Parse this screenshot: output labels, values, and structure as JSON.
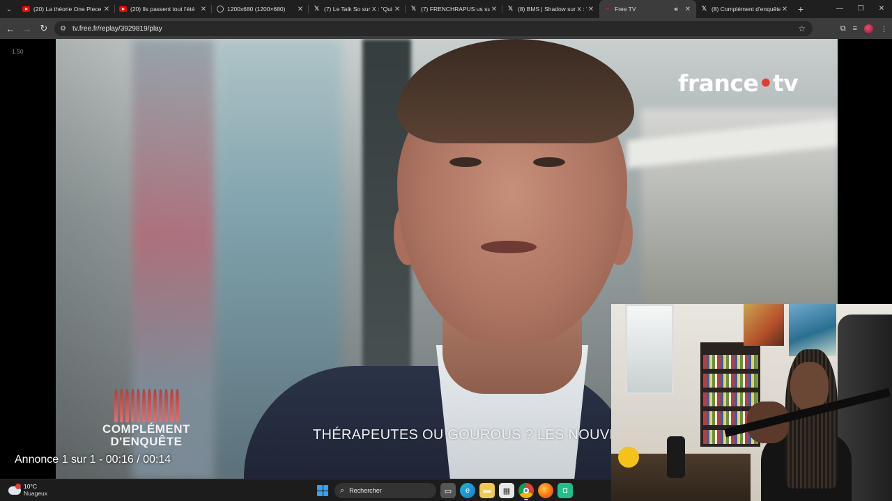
{
  "browser": {
    "tabs": [
      {
        "title": "(20) La théorie One Piece",
        "favicon": "youtube-icon",
        "active": false
      },
      {
        "title": "(20) Ils passent tout l'été",
        "favicon": "youtube-icon",
        "active": false
      },
      {
        "title": "1200x680 (1200×680)",
        "favicon": "globe-icon",
        "active": false
      },
      {
        "title": "(7) Le Talk So sur X : \"Qui",
        "favicon": "x-icon",
        "active": false
      },
      {
        "title": "(7) FRENCHRAPUS us sur",
        "favicon": "x-icon",
        "active": false
      },
      {
        "title": "(8) BMS | Shadow sur X : \"",
        "favicon": "x-icon",
        "active": false
      },
      {
        "title": "Free TV",
        "favicon": "free-icon",
        "active": true,
        "audio": true
      },
      {
        "title": "(8) Complément d'enquête",
        "favicon": "x-icon",
        "active": false
      }
    ],
    "url": "tv.free.fr/replay/3929819/play",
    "accent": "#3c3c3c"
  },
  "player": {
    "speed_label": "1.50",
    "channel_logo_main": "france",
    "channel_logo_dot": "•",
    "channel_logo_suffix": "tv",
    "show_logo": "COMPLÉMENT D'ENQUÊTE",
    "show_logo_line1": "COMPLÉMENT",
    "show_logo_line2": "D'ENQUÊTE",
    "subtitle": "THÉRAPEUTES OU GOUROUS ? LES NOUVEA",
    "ad_info": "Annonce 1 sur 1 - 00:16 / 00:14",
    "logo_dot_color": "#e53935"
  },
  "taskbar": {
    "weather_temp": "10°C",
    "weather_condition": "Nuageux",
    "search_placeholder": "Rechercher",
    "apps": [
      "task-view-icon",
      "edge-icon",
      "file-explorer-icon",
      "store-icon",
      "chrome-icon",
      "firefox-icon",
      "app-icon"
    ]
  }
}
